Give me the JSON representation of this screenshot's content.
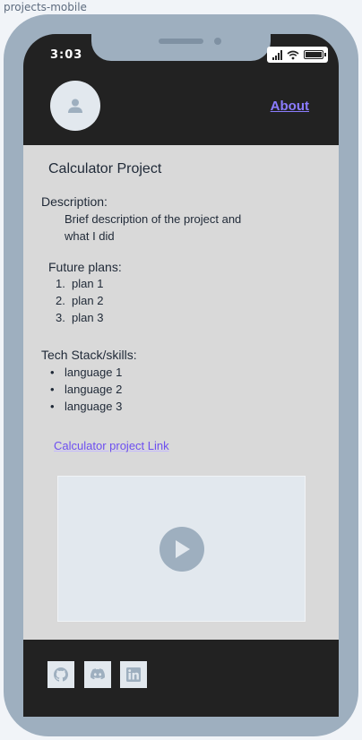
{
  "frame_label": "projects-mobile",
  "status_bar": {
    "time": "3:03"
  },
  "header": {
    "about_label": "About"
  },
  "project": {
    "title": "Calculator Project",
    "description_label": "Description:",
    "description_text": "Brief description of the project and what I did",
    "future_label": "Future plans:",
    "plans": [
      {
        "num": "1.",
        "text": "plan 1"
      },
      {
        "num": "2.",
        "text": "plan 2"
      },
      {
        "num": "3.",
        "text": "plan 3"
      }
    ],
    "tech_label": "Tech Stack/skills:",
    "tech": [
      "language 1",
      "language 2",
      "language 3"
    ],
    "link_label": "Calculator project Link"
  },
  "footer": {
    "socials": [
      "github-icon",
      "discord-icon",
      "linkedin-icon"
    ]
  },
  "colors": {
    "device": "#9eafbf",
    "dark": "#222222",
    "content_bg": "#d9d9d9",
    "link": "#6d4ff0"
  }
}
